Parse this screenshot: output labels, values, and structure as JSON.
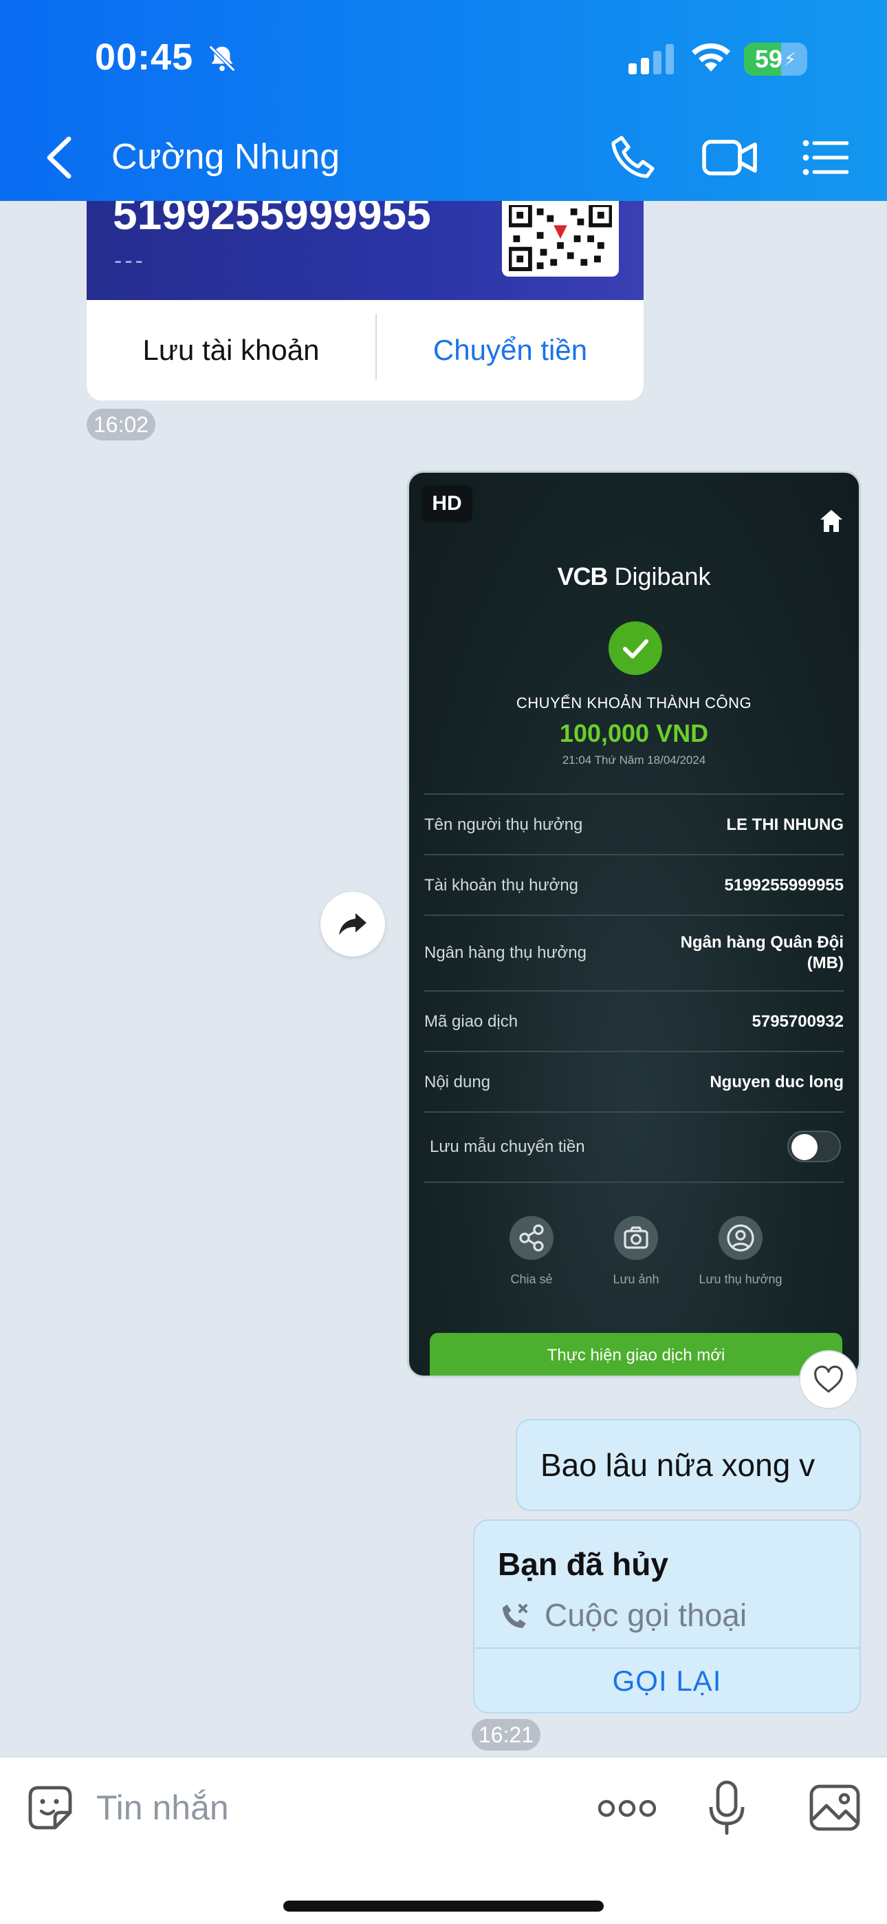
{
  "status_bar": {
    "time": "00:45",
    "battery": "59",
    "battery_level_percent": 59,
    "icons": [
      "bell-off-icon",
      "signal-icon",
      "wifi-icon",
      "battery-charging-icon"
    ]
  },
  "header": {
    "title": "Cường Nhung",
    "icons": [
      "back-chevron-icon",
      "phone-icon",
      "video-camera-icon",
      "list-menu-icon"
    ],
    "accent_color": "#0a6cf2"
  },
  "account_card": {
    "account_number": "5199255999955",
    "subtitle": "---",
    "save_label": "Lưu tài khoản",
    "transfer_label": "Chuyển tiền",
    "time": "16:02"
  },
  "receipt": {
    "badge": "HD",
    "logo_bold": "VCB",
    "logo_rest": "Digibank",
    "status": "CHUYỂN KHOẢN THÀNH CÔNG",
    "amount": "100,000 VND",
    "datetime": "21:04 Thứ Năm 18/04/2024",
    "rows": [
      {
        "label": "Tên người thụ hưởng",
        "value": "LE THI NHUNG"
      },
      {
        "label": "Tài khoản thụ hưởng",
        "value": "5199255999955"
      },
      {
        "label": "Ngân hàng thụ hưởng",
        "value": "Ngân hàng Quân Đội (MB)"
      },
      {
        "label": "Mã giao dịch",
        "value": "5795700932"
      },
      {
        "label": "Nội dung",
        "value": "Nguyen duc long"
      }
    ],
    "save_template_label": "Lưu mẫu chuyển tiền",
    "actions": [
      {
        "label": "Chia sẻ",
        "icon": "share-icon"
      },
      {
        "label": "Lưu ảnh",
        "icon": "camera-icon"
      },
      {
        "label": "Lưu thụ hưởng",
        "icon": "person-icon"
      }
    ],
    "new_transaction_label": "Thực hiện giao dịch mới",
    "success_color": "#4caf20"
  },
  "messages": {
    "text_message": "Bao lâu nữa xong v",
    "call": {
      "title": "Bạn đã hủy",
      "subtitle": "Cuộc gọi thoại",
      "action": "GỌI LẠI"
    },
    "time": "16:21"
  },
  "composer": {
    "placeholder": "Tin nhắn",
    "icons": [
      "sticker-icon",
      "more-dots-icon",
      "microphone-icon",
      "image-icon"
    ]
  }
}
